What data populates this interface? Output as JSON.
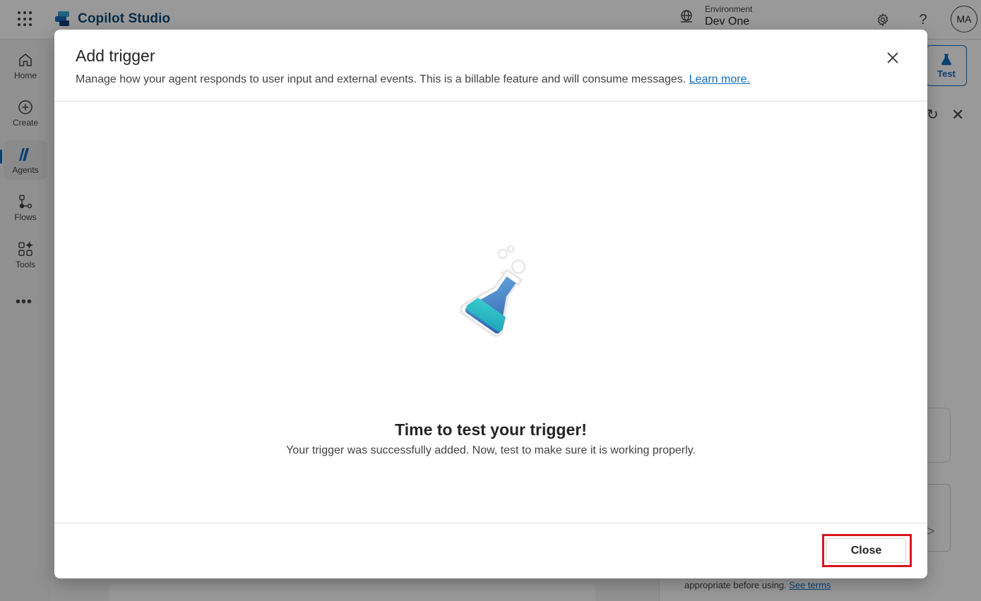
{
  "app": {
    "title": "Copilot Studio",
    "environment_label": "Environment",
    "environment_value": "Dev One",
    "avatar_initials": "MA"
  },
  "nav": {
    "items": [
      {
        "label": "Home",
        "icon": "home-icon"
      },
      {
        "label": "Create",
        "icon": "plus-circle-icon"
      },
      {
        "label": "Agents",
        "icon": "agents-icon",
        "active": true
      },
      {
        "label": "Flows",
        "icon": "flows-icon"
      },
      {
        "label": "Tools",
        "icon": "tools-icon"
      }
    ],
    "more_label": "•••"
  },
  "right_panel": {
    "test_label": "Test",
    "disclaimer": "appropriate before using.",
    "terms_link": "See terms"
  },
  "dialog": {
    "title": "Add trigger",
    "description": "Manage how your agent responds to user input and external events. This is a billable feature and will consume messages.",
    "learn_more": "Learn more.",
    "heading": "Time to test your trigger!",
    "subtext": "Your trigger was successfully added. Now, test to make sure it is working properly.",
    "close_button": "Close"
  },
  "colors": {
    "accent": "#0f6cbd",
    "brand_text": "#0f4a75",
    "highlight_border": "#d9151b",
    "flask_top": "#5aa0d8",
    "flask_liquid": "#2ec4c9"
  }
}
